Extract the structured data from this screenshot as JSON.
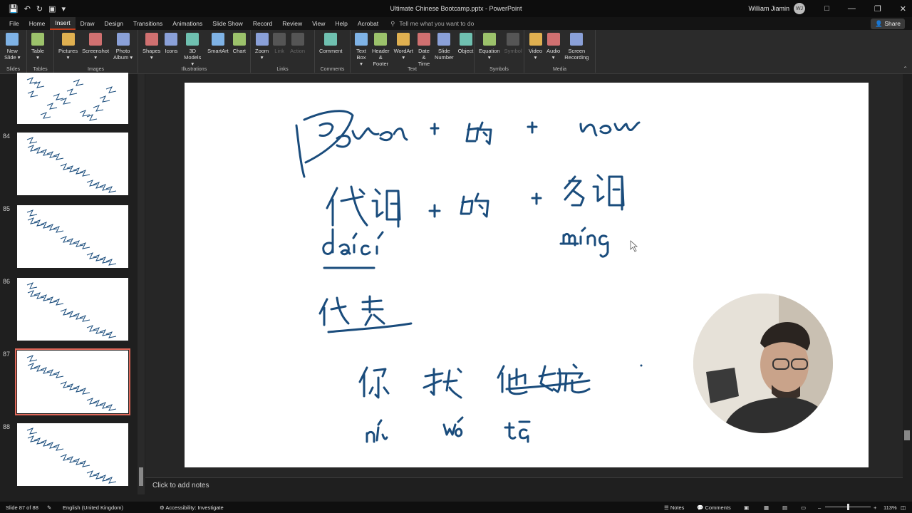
{
  "window": {
    "title": "Ultimate Chinese Bootcamp.pptx  -  PowerPoint",
    "user_name": "William Jiamin",
    "user_initials": "WJ",
    "share_label": "Share"
  },
  "tabs": [
    "File",
    "Home",
    "Insert",
    "Draw",
    "Design",
    "Transitions",
    "Animations",
    "Slide Show",
    "Record",
    "Review",
    "View",
    "Help",
    "Acrobat"
  ],
  "active_tab": "Insert",
  "tell_me_placeholder": "Tell me what you want to do",
  "ribbon": {
    "groups": [
      {
        "label": "Slides",
        "buttons": [
          {
            "line1": "New",
            "line2": "Slide ▾",
            "enabled": true
          }
        ]
      },
      {
        "label": "Tables",
        "buttons": [
          {
            "line1": "Table",
            "line2": "▾",
            "enabled": true
          }
        ]
      },
      {
        "label": "Images",
        "buttons": [
          {
            "line1": "Pictures",
            "line2": "▾",
            "enabled": true
          },
          {
            "line1": "Screenshot",
            "line2": "▾",
            "enabled": true
          },
          {
            "line1": "Photo",
            "line2": "Album ▾",
            "enabled": true
          }
        ]
      },
      {
        "label": "Illustrations",
        "buttons": [
          {
            "line1": "Shapes",
            "line2": "▾",
            "enabled": true
          },
          {
            "line1": "Icons",
            "line2": "",
            "enabled": true
          },
          {
            "line1": "3D",
            "line2": "Models ▾",
            "enabled": true
          },
          {
            "line1": "SmartArt",
            "line2": "",
            "enabled": true
          },
          {
            "line1": "Chart",
            "line2": "",
            "enabled": true
          }
        ]
      },
      {
        "label": "Links",
        "buttons": [
          {
            "line1": "Zoom",
            "line2": "▾",
            "enabled": true
          },
          {
            "line1": "Link",
            "line2": "",
            "enabled": false
          },
          {
            "line1": "Action",
            "line2": "",
            "enabled": false
          }
        ]
      },
      {
        "label": "Comments",
        "buttons": [
          {
            "line1": "Comment",
            "line2": "",
            "enabled": true
          }
        ]
      },
      {
        "label": "Text",
        "buttons": [
          {
            "line1": "Text",
            "line2": "Box ▾",
            "enabled": true
          },
          {
            "line1": "Header",
            "line2": "& Footer",
            "enabled": true
          },
          {
            "line1": "WordArt",
            "line2": "▾",
            "enabled": true
          },
          {
            "line1": "Date &",
            "line2": "Time",
            "enabled": true
          },
          {
            "line1": "Slide",
            "line2": "Number",
            "enabled": true
          },
          {
            "line1": "Object",
            "line2": "",
            "enabled": true
          }
        ]
      },
      {
        "label": "Symbols",
        "buttons": [
          {
            "line1": "Equation",
            "line2": "▾",
            "enabled": true
          },
          {
            "line1": "Symbol",
            "line2": "",
            "enabled": false
          }
        ]
      },
      {
        "label": "Media",
        "buttons": [
          {
            "line1": "Video",
            "line2": "▾",
            "enabled": true
          },
          {
            "line1": "Audio",
            "line2": "▾",
            "enabled": true
          },
          {
            "line1": "Screen",
            "line2": "Recording",
            "enabled": true
          }
        ]
      }
    ]
  },
  "thumbnails": [
    {
      "number": "",
      "selected": false
    },
    {
      "number": "84",
      "selected": false
    },
    {
      "number": "85",
      "selected": false
    },
    {
      "number": "86",
      "selected": false
    },
    {
      "number": "87",
      "selected": true
    },
    {
      "number": "88",
      "selected": false
    }
  ],
  "notes_placeholder": "Click to add notes",
  "status": {
    "slide_info": "Slide 87 of 88",
    "language": "English (United Kingdom)",
    "accessibility": "Accessibility: Investigate",
    "notes_label": "Notes",
    "comments_label": "Comments",
    "zoom": "113%"
  },
  "colors": {
    "accent": "#c43e1c",
    "ink": "#1a4c7c",
    "selected_thumb_border": "#e0685a"
  }
}
